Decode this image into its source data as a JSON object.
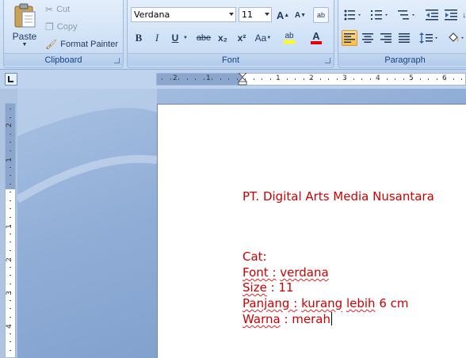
{
  "clipboard": {
    "label": "Clipboard",
    "paste": "Paste",
    "cut": "Cut",
    "copy": "Copy",
    "format_painter": "Format Painter"
  },
  "font": {
    "label": "Font",
    "family": "Verdana",
    "size": "11",
    "bold": "B",
    "italic": "I",
    "underline": "U",
    "strike": "abe",
    "subscript": "x₂",
    "superscript": "x²",
    "change_case": "Aa",
    "grow": "A",
    "shrink": "A",
    "highlight": "ab",
    "color_a": "A",
    "clear": "ab"
  },
  "paragraph": {
    "label": "Paragraph"
  },
  "colors": {
    "text": "#cc0000",
    "ribbon": "#c5d9f1",
    "font_color_bar": "#e00000",
    "highlight_bar": "#ffff00"
  },
  "hruler_ticks": [
    "2",
    "1",
    "1",
    "2",
    "3",
    "4",
    "5",
    "6"
  ],
  "vruler_ticks": [
    "2",
    "1",
    "1",
    "2",
    "3",
    "4"
  ],
  "doc": {
    "company": "PT. Digital  Arts  Media Nusantara",
    "cat": "Cat:",
    "font_label": "Font :",
    "font_value": "verdana",
    "size_label": "Size",
    "size_value": " : 11",
    "panjang_label": "Panjang :",
    "panjang_value1": "kurang",
    "panjang_value2": "lebih",
    "panjang_value3": " 6 cm",
    "warna_label": "Warna",
    "warna_value": " : merah"
  }
}
